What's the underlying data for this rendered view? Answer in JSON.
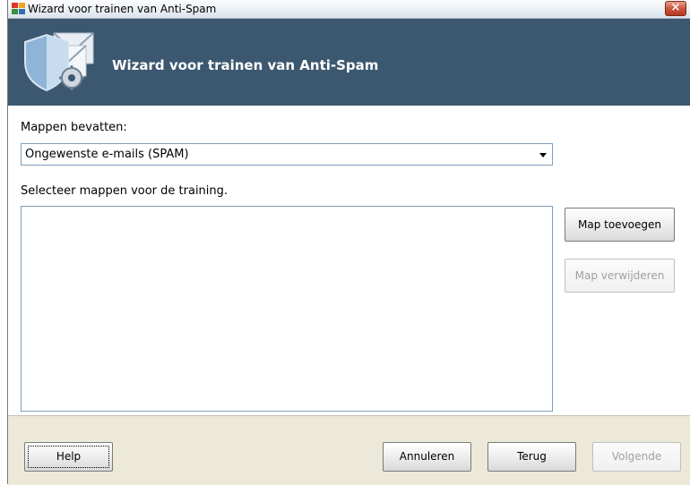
{
  "window": {
    "title": "Wizard voor trainen van Anti-Spam",
    "close_label": "×"
  },
  "header": {
    "title": "Wizard voor trainen van Anti-Spam"
  },
  "form": {
    "folders_label": "Mappen bevatten:",
    "folder_type_value": "Ongewenste e-mails (SPAM)",
    "select_label": "Selecteer mappen voor de training."
  },
  "buttons": {
    "add_folder": "Map toevoegen",
    "remove_folder": "Map verwijderen",
    "help": "Help",
    "cancel": "Annuleren",
    "back": "Terug",
    "next": "Volgende"
  },
  "colors": {
    "header_bg": "#3c5870",
    "accent": "#2e6fb5"
  }
}
